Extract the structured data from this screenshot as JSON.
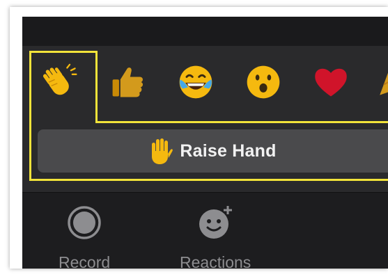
{
  "reactions": {
    "items": [
      {
        "name": "clapping-hands",
        "emoji": "👏"
      },
      {
        "name": "thumbs-up",
        "emoji": "👍"
      },
      {
        "name": "tears-of-joy",
        "emoji": "😂"
      },
      {
        "name": "open-mouth",
        "emoji": "😮"
      },
      {
        "name": "heart",
        "emoji": "❤️"
      },
      {
        "name": "party-popper",
        "emoji": "🎉"
      }
    ],
    "raise_hand_label": "Raise Hand",
    "highlight_color": "#f2e33a"
  },
  "toolbar": {
    "record_label": "Record",
    "reactions_label": "Reactions"
  },
  "colors": {
    "panel": "#2a2a2c",
    "toolbar": "#1d1d1f",
    "button": "#4a4a4c",
    "emoji_yellow": "#f5b90f",
    "heart_red": "#d0142a"
  }
}
